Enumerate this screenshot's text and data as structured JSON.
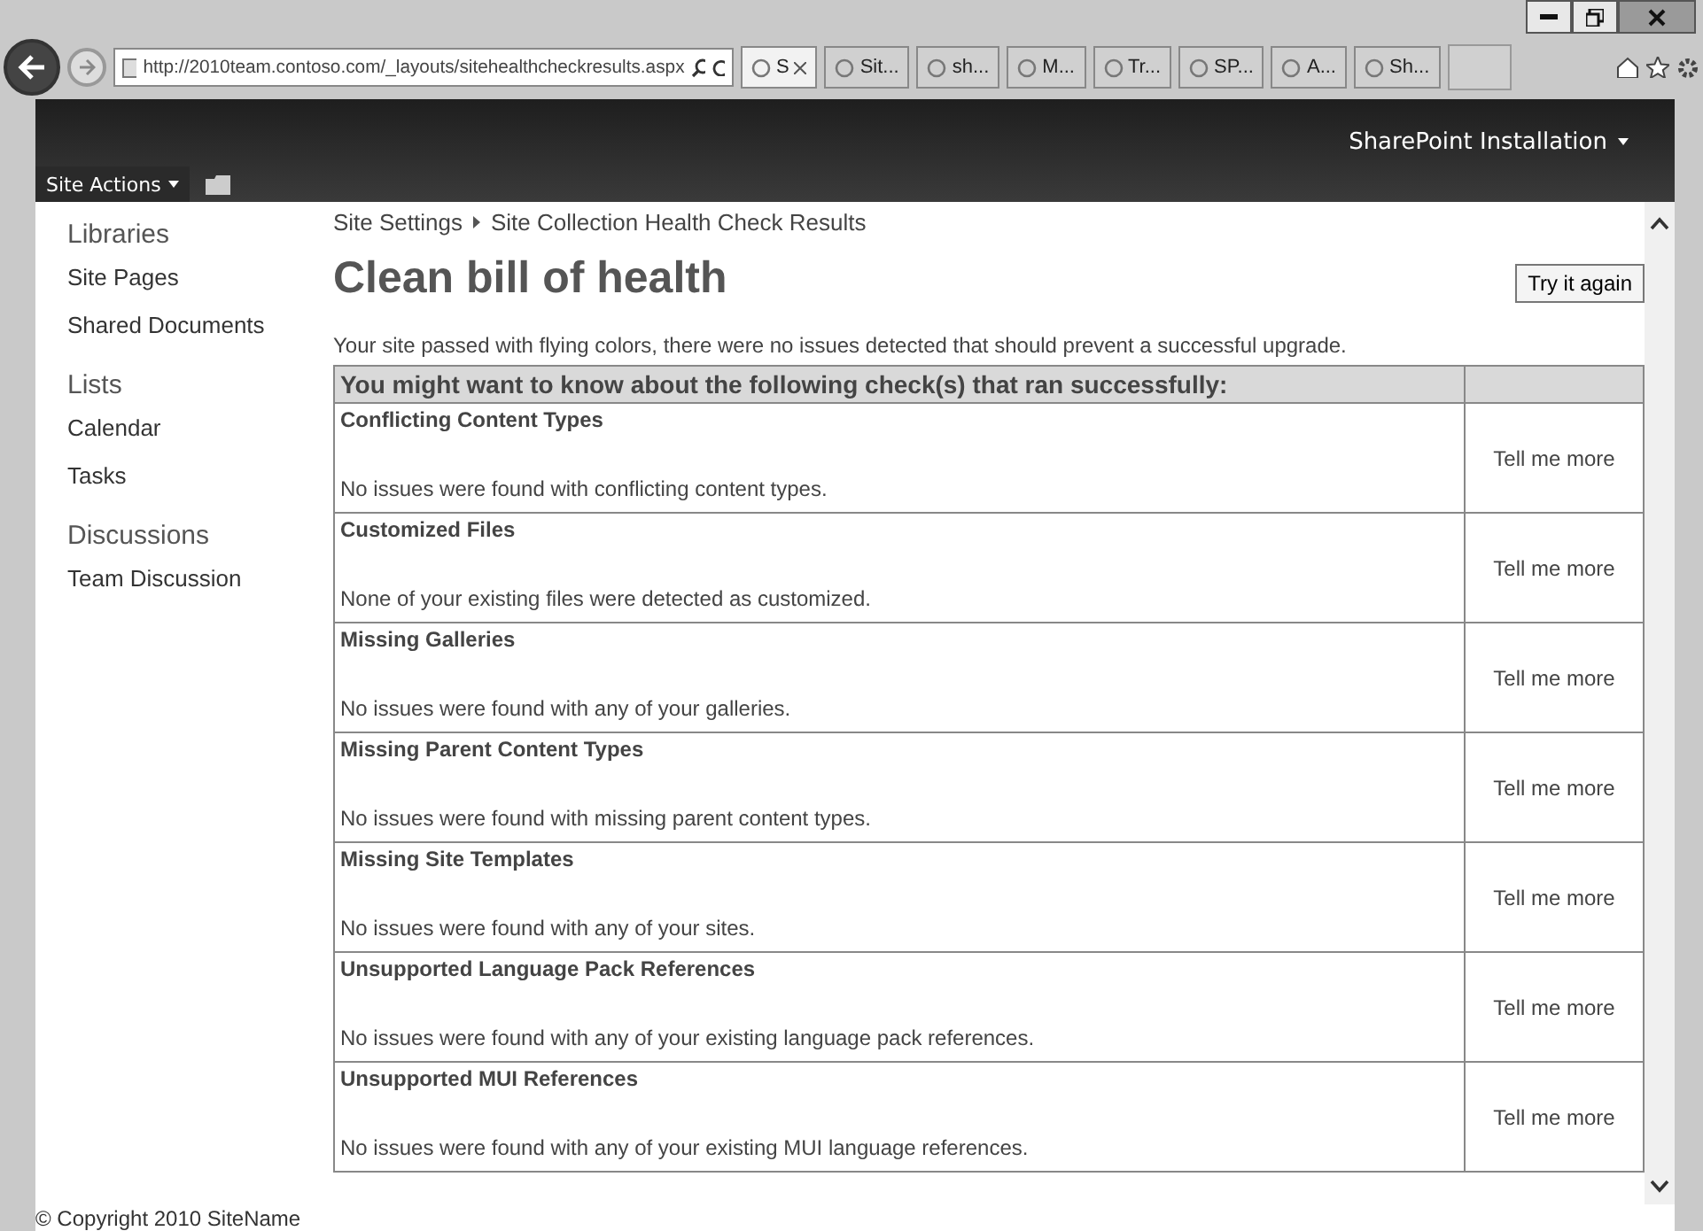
{
  "browser": {
    "address": "http://2010team.contoso.com/_layouts/sitehealthcheckresults.aspx",
    "tabs": [
      {
        "label": "S",
        "selected": true,
        "closable": true
      },
      {
        "label": "Sit...",
        "selected": false,
        "closable": false
      },
      {
        "label": "sh...",
        "selected": false,
        "closable": false
      },
      {
        "label": "M...",
        "selected": false,
        "closable": false
      },
      {
        "label": "Tr...",
        "selected": false,
        "closable": false
      },
      {
        "label": "SP...",
        "selected": false,
        "closable": false
      },
      {
        "label": "A...",
        "selected": false,
        "closable": false
      },
      {
        "label": "Sh...",
        "selected": false,
        "closable": false
      }
    ]
  },
  "ribbon": {
    "site_actions": "Site Actions",
    "user": "SharePoint Installation"
  },
  "sidebar": {
    "sections": [
      {
        "heading": "Libraries",
        "items": [
          "Site Pages",
          "Shared Documents"
        ]
      },
      {
        "heading": "Lists",
        "items": [
          "Calendar",
          "Tasks"
        ]
      },
      {
        "heading": "Discussions",
        "items": [
          "Team Discussion"
        ]
      }
    ]
  },
  "breadcrumb": [
    "Site Settings",
    "Site Collection Health Check Results"
  ],
  "title": "Clean bill of health",
  "retry_button": "Try it again",
  "summary": "Your site passed with flying colors, there were no issues detected that should prevent a successful upgrade.",
  "table": {
    "header": "You might want to know about the following check(s) that ran successfully:",
    "rows": [
      {
        "name": "Conflicting Content Types",
        "message": "No issues were found with conflicting content types.",
        "link": "Tell me more"
      },
      {
        "name": "Customized Files",
        "message": "None of your existing files were detected as customized.",
        "link": "Tell me more"
      },
      {
        "name": "Missing Galleries",
        "message": "No issues were found with any of your galleries.",
        "link": "Tell me more"
      },
      {
        "name": "Missing Parent Content Types",
        "message": "No issues were found with missing parent content types.",
        "link": "Tell me more"
      },
      {
        "name": "Missing Site Templates",
        "message": "No issues were found with any of your sites.",
        "link": "Tell me more"
      },
      {
        "name": "Unsupported Language Pack References",
        "message": "No issues were found with any of your existing language pack references.",
        "link": "Tell me more"
      },
      {
        "name": "Unsupported MUI References",
        "message": "No issues were found with any of your existing MUI language references.",
        "link": "Tell me more"
      }
    ]
  },
  "footer": "© Copyright 2010 SiteName"
}
